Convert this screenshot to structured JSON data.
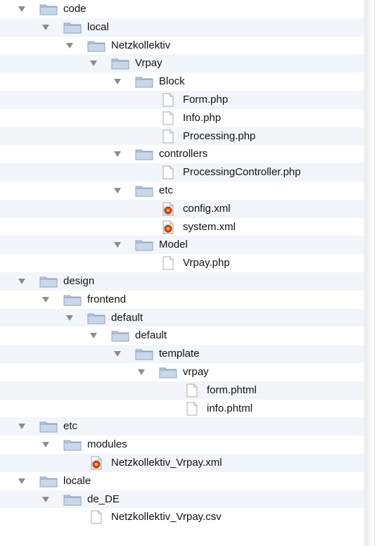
{
  "tree": [
    {
      "label": "code",
      "type": "folder",
      "depth": 0,
      "expanded": true
    },
    {
      "label": "local",
      "type": "folder",
      "depth": 1,
      "expanded": true
    },
    {
      "label": "Netzkollektiv",
      "type": "folder",
      "depth": 2,
      "expanded": true
    },
    {
      "label": "Vrpay",
      "type": "folder",
      "depth": 3,
      "expanded": true
    },
    {
      "label": "Block",
      "type": "folder",
      "depth": 4,
      "expanded": true
    },
    {
      "label": "Form.php",
      "type": "file",
      "depth": 5
    },
    {
      "label": "Info.php",
      "type": "file",
      "depth": 5
    },
    {
      "label": "Processing.php",
      "type": "file",
      "depth": 5
    },
    {
      "label": "controllers",
      "type": "folder",
      "depth": 4,
      "expanded": true
    },
    {
      "label": "ProcessingController.php",
      "type": "file",
      "depth": 5
    },
    {
      "label": "etc",
      "type": "folder",
      "depth": 4,
      "expanded": true
    },
    {
      "label": "config.xml",
      "type": "xml",
      "depth": 5
    },
    {
      "label": "system.xml",
      "type": "xml",
      "depth": 5
    },
    {
      "label": "Model",
      "type": "folder",
      "depth": 4,
      "expanded": true
    },
    {
      "label": "Vrpay.php",
      "type": "file",
      "depth": 5
    },
    {
      "label": "design",
      "type": "folder",
      "depth": 0,
      "expanded": true
    },
    {
      "label": "frontend",
      "type": "folder",
      "depth": 1,
      "expanded": true
    },
    {
      "label": "default",
      "type": "folder",
      "depth": 2,
      "expanded": true
    },
    {
      "label": "default",
      "type": "folder",
      "depth": 3,
      "expanded": true
    },
    {
      "label": "template",
      "type": "folder",
      "depth": 4,
      "expanded": true
    },
    {
      "label": "vrpay",
      "type": "folder",
      "depth": 5,
      "expanded": true
    },
    {
      "label": "form.phtml",
      "type": "file",
      "depth": 6
    },
    {
      "label": "info.phtml",
      "type": "file",
      "depth": 6
    },
    {
      "label": "etc",
      "type": "folder",
      "depth": 0,
      "expanded": true
    },
    {
      "label": "modules",
      "type": "folder",
      "depth": 1,
      "expanded": true
    },
    {
      "label": "Netzkollektiv_Vrpay.xml",
      "type": "xml",
      "depth": 2
    },
    {
      "label": "locale",
      "type": "folder",
      "depth": 0,
      "expanded": true
    },
    {
      "label": "de_DE",
      "type": "folder",
      "depth": 1,
      "expanded": true
    },
    {
      "label": "Netzkollektiv_Vrpay.csv",
      "type": "file",
      "depth": 2
    }
  ],
  "colors": {
    "row_alt": "#f2f5fa",
    "folder_fill": "#c9d8e8",
    "folder_tab": "#b5c7db",
    "disclosure": "#8c8c8c",
    "xml_badge": "#d84a1b"
  },
  "icons": {
    "folder": "folder-icon",
    "file": "document-icon",
    "xml": "xml-file-icon",
    "disclosure": "disclosure-triangle-icon"
  }
}
